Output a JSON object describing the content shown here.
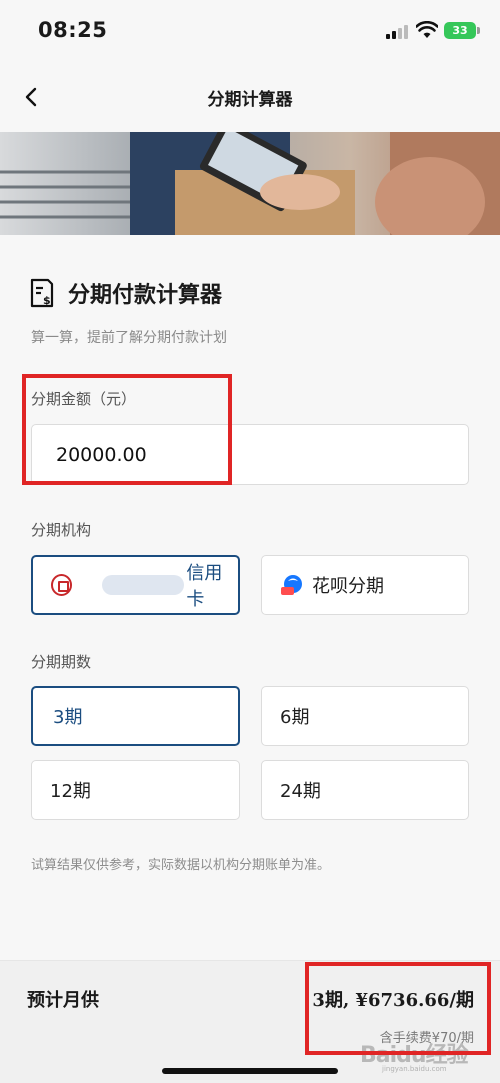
{
  "status_bar": {
    "time": "08:25",
    "battery": "33"
  },
  "nav": {
    "title": "分期计算器"
  },
  "calculator": {
    "title": "分期付款计算器",
    "subtitle": "算一算，提前了解分期付款计划",
    "amount_label": "分期金额（元）",
    "amount_value": "20000.00",
    "institution_label": "分期机构",
    "institutions": [
      {
        "label": "信用卡",
        "selected": true
      },
      {
        "label": "花呗分期",
        "selected": false
      }
    ],
    "terms_label": "分期期数",
    "terms": [
      {
        "label": "3期",
        "selected": true
      },
      {
        "label": "6期",
        "selected": false
      },
      {
        "label": "12期",
        "selected": false
      },
      {
        "label": "24期",
        "selected": false
      }
    ],
    "disclaimer": "试算结果仅供参考，实际数据以机构分期账单为准。"
  },
  "footer": {
    "label": "预计月供",
    "result": "3期, ¥6736.66/期",
    "fee": "含手续费¥70/期",
    "watermark": "Baidu经验",
    "watermark_url": "jingyan.baidu.com"
  },
  "colors": {
    "accent": "#1b4d80",
    "highlight_box": "#e02525",
    "battery": "#35c759"
  }
}
